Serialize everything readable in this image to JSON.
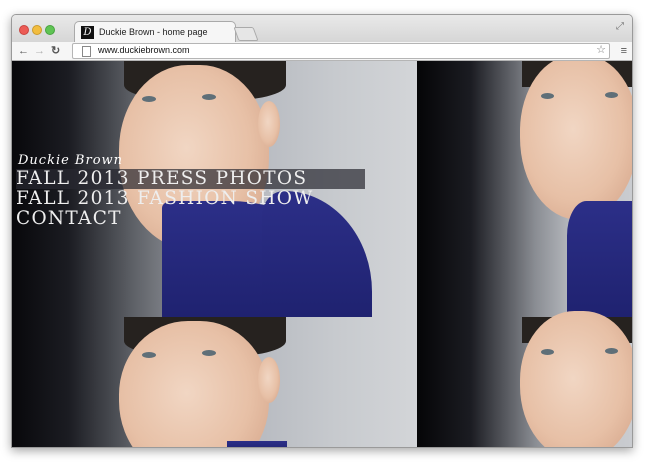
{
  "browser": {
    "tab": {
      "title": "Duckie Brown - home page",
      "favicon_letter": "D"
    },
    "url": "www.duckiebrown.com",
    "nav": {
      "back": "←",
      "forward": "→",
      "reload": "↻"
    },
    "icons": {
      "page": "page-icon",
      "star": "star-icon",
      "menu": "hamburger-menu-icon",
      "resize": "fullscreen-icon"
    }
  },
  "site": {
    "logo": "Duckie Brown",
    "menu": [
      {
        "label": "FALL 2013 PRESS PHOTOS",
        "highlighted": true
      },
      {
        "label": "FALL 2013 FASHION SHOW",
        "highlighted": false
      },
      {
        "label": "CONTACT",
        "highlighted": false
      }
    ]
  },
  "colors": {
    "sweater": "#2a2d86",
    "background_dark": "#1d1d22",
    "menu_highlight": "#2a2a30"
  }
}
